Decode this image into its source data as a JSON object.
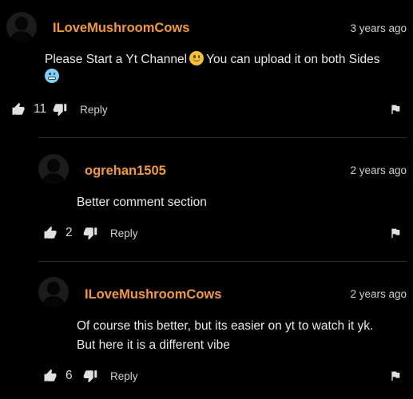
{
  "colors": {
    "background": "#000000",
    "username": "#f29a38",
    "text": "#e8e8e8",
    "muted": "#cfcfcf",
    "divider": "#2c2c2c"
  },
  "comments": [
    {
      "username": "ILoveMushroomCows",
      "timestamp": "3 years ago",
      "text_part1": "Please Start a Yt Channel",
      "text_part2": "You can upload it on both Sides",
      "emoji_1": "slightly-smiling-face",
      "emoji_2": "cold-face",
      "like_count": "11",
      "reply_label": "Reply",
      "icons": {
        "like": "thumb-up-icon",
        "dislike": "thumb-down-icon",
        "flag": "flag-icon"
      }
    },
    {
      "username": "ogrehan1505",
      "timestamp": "2 years ago",
      "text_line1": "Better comment section",
      "like_count": "2",
      "reply_label": "Reply",
      "icons": {
        "like": "thumb-up-icon",
        "dislike": "thumb-down-icon",
        "flag": "flag-icon"
      }
    },
    {
      "username": "ILoveMushroomCows",
      "timestamp": "2 years ago",
      "text_line1": "Of course this better, but its easier on yt to watch it yk.",
      "text_line2": "But here it is a different vibe",
      "like_count": "6",
      "reply_label": "Reply",
      "icons": {
        "like": "thumb-up-icon",
        "dislike": "thumb-down-icon",
        "flag": "flag-icon"
      }
    }
  ]
}
